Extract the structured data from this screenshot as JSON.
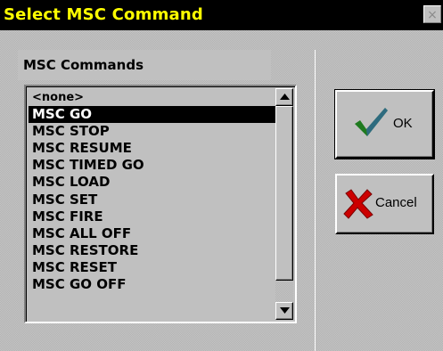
{
  "window": {
    "title": "Select MSC Command",
    "close_glyph": "×"
  },
  "list": {
    "label": "MSC Commands",
    "selected_index": 1,
    "items": [
      "<none>",
      "MSC GO",
      "MSC STOP",
      "MSC RESUME",
      "MSC TIMED GO",
      "MSC LOAD",
      "MSC SET",
      "MSC FIRE",
      "MSC ALL OFF",
      "MSC RESTORE",
      "MSC RESET",
      "MSC GO OFF"
    ]
  },
  "buttons": {
    "ok": {
      "label": "OK",
      "icon": "checkmark-icon",
      "icon_color": "#1f7a1f",
      "icon_accent": "#3a5fcd"
    },
    "cancel": {
      "label": "Cancel",
      "icon": "x-cross-icon",
      "icon_color": "#cc0000"
    }
  },
  "colors": {
    "title_bg": "#000000",
    "title_text": "#ffff00",
    "selection_bg": "#000000",
    "selection_text": "#ffffff"
  }
}
